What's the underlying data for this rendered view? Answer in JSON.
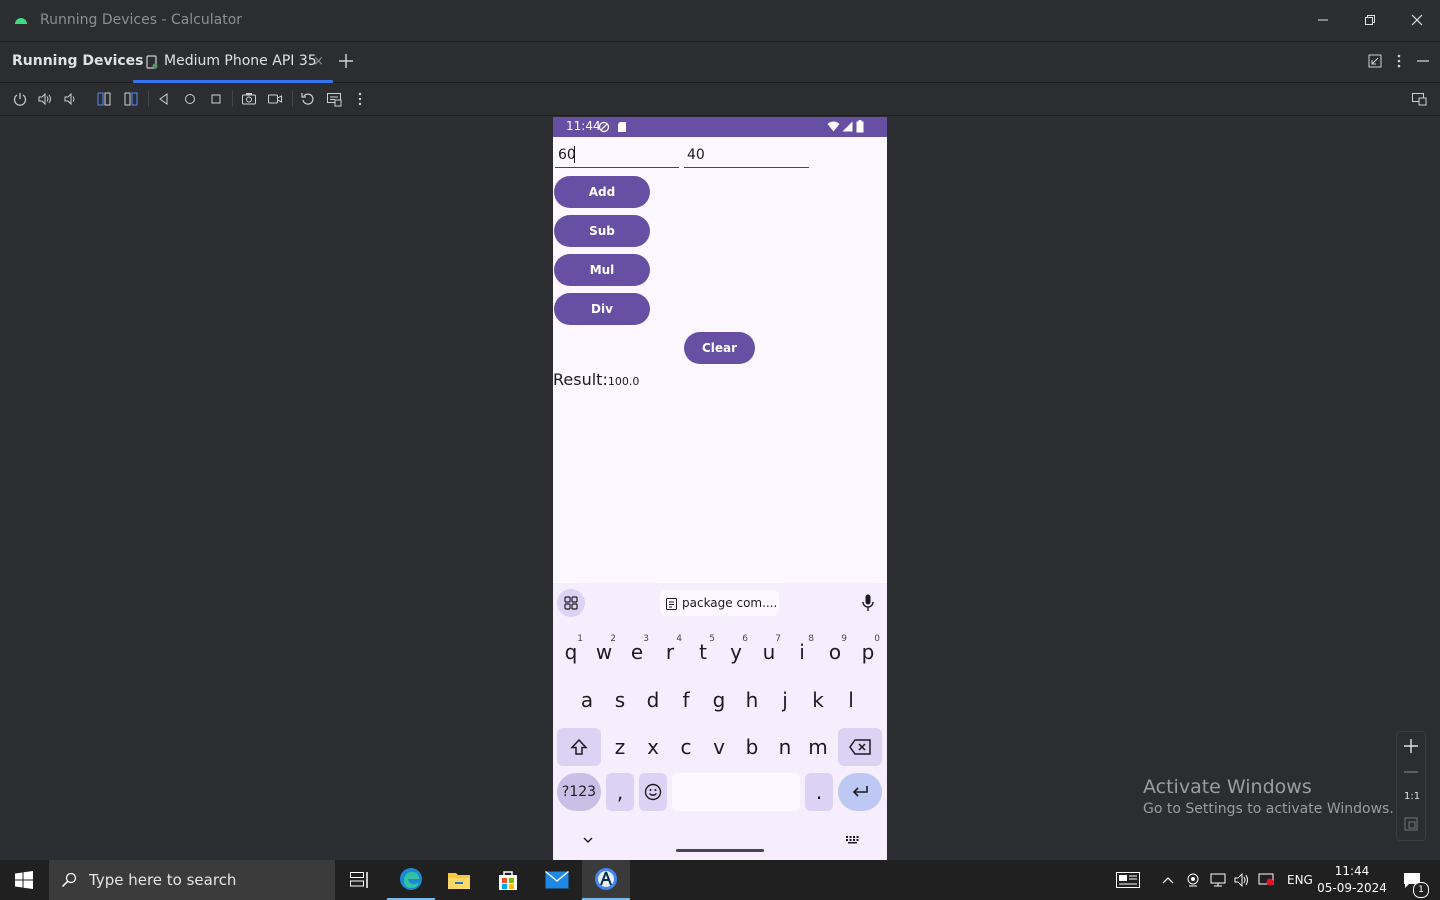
{
  "window": {
    "title": "Running Devices - Calculator"
  },
  "panel": {
    "name": "Running Devices"
  },
  "tabs": [
    {
      "label": "Medium Phone API 35",
      "close": "×"
    }
  ],
  "phone": {
    "status_time": "11:44",
    "input1": "60",
    "input2": "40",
    "buttons": {
      "add": "Add",
      "sub": "Sub",
      "mul": "Mul",
      "div": "Div",
      "clear": "Clear"
    },
    "result_label": "Result:",
    "result_value": "100.0",
    "accent": "#6750a4"
  },
  "keyboard": {
    "clipboard_suggestion": "package com....",
    "row1": [
      {
        "k": "q",
        "h": "1"
      },
      {
        "k": "w",
        "h": "2"
      },
      {
        "k": "e",
        "h": "3"
      },
      {
        "k": "r",
        "h": "4"
      },
      {
        "k": "t",
        "h": "5"
      },
      {
        "k": "y",
        "h": "6"
      },
      {
        "k": "u",
        "h": "7"
      },
      {
        "k": "i",
        "h": "8"
      },
      {
        "k": "o",
        "h": "9"
      },
      {
        "k": "p",
        "h": "0"
      }
    ],
    "row2": [
      "a",
      "s",
      "d",
      "f",
      "g",
      "h",
      "j",
      "k",
      "l"
    ],
    "row3": [
      "z",
      "x",
      "c",
      "v",
      "b",
      "n",
      "m"
    ],
    "symbols_key": "?123",
    "comma": ",",
    "period": "."
  },
  "zoom_controls": {
    "actual_size": "1:1"
  },
  "watermark": {
    "line1": "Activate Windows",
    "line2": "Go to Settings to activate Windows."
  },
  "taskbar": {
    "search_placeholder": "Type here to search",
    "language": "ENG",
    "time": "11:44",
    "date": "05-09-2024",
    "notification_count": "1"
  }
}
